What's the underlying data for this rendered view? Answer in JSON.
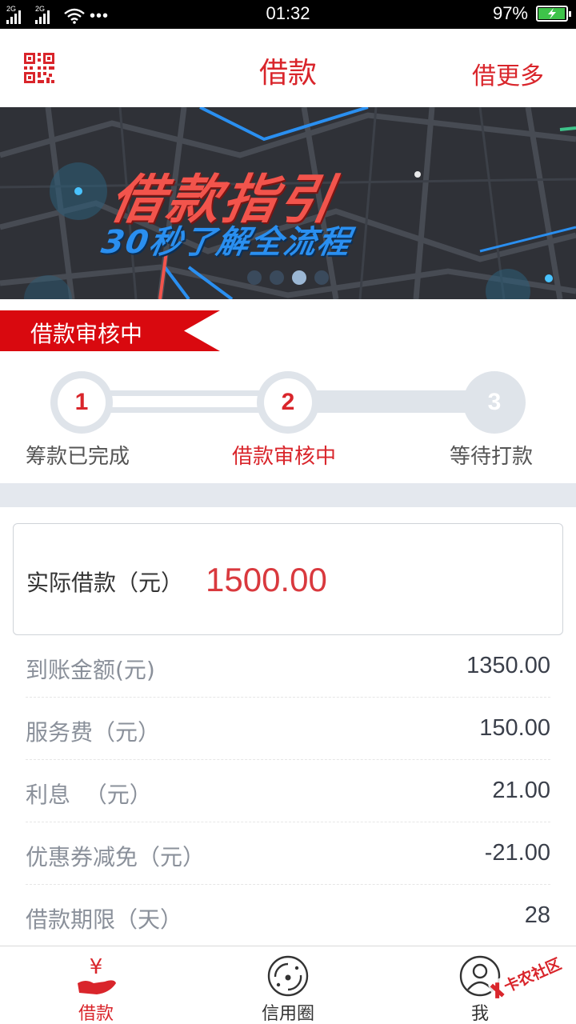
{
  "status_bar": {
    "network_1": "2G",
    "network_2": "2G",
    "more": "•••",
    "time": "01:32",
    "battery_percent": "97%",
    "battery_level": 0.97,
    "battery_color": "#3ec34a"
  },
  "header": {
    "qr_icon": "qr-code-icon",
    "title": "借款",
    "more_link": "借更多"
  },
  "banner": {
    "title": "借款指引",
    "subtitle": "30秒了解全流程",
    "pages": 4,
    "active_page": 3
  },
  "status_ribbon": {
    "text": "借款审核中"
  },
  "steps": [
    {
      "number": "1",
      "label": "筹款已完成",
      "state": "done"
    },
    {
      "number": "2",
      "label": "借款审核中",
      "state": "active"
    },
    {
      "number": "3",
      "label": "等待打款",
      "state": "pending"
    }
  ],
  "amount_card": {
    "label": "实际借款（元）",
    "value": "1500.00"
  },
  "details": [
    {
      "label": "到账金额(元)",
      "value": "1350.00"
    },
    {
      "label": "服务费（元）",
      "value": "150.00"
    },
    {
      "label": "利息  （元）",
      "value": "21.00"
    },
    {
      "label": "优惠券减免（元）",
      "value": "-21.00"
    },
    {
      "label": "借款期限（天）",
      "value": "28"
    }
  ],
  "tabbar": {
    "tabs": [
      {
        "label": "借款",
        "icon": "yen-hand-icon",
        "active": true
      },
      {
        "label": "信用圈",
        "icon": "credit-circle-icon",
        "active": false
      },
      {
        "label": "我",
        "icon": "user-icon",
        "active": false
      }
    ]
  },
  "watermark": {
    "text": "卡农社区"
  },
  "colors": {
    "accent": "#d9252b",
    "amount_red": "#d9393e",
    "divider": "#e4e8ee",
    "banner_bg": "#2f3137"
  }
}
